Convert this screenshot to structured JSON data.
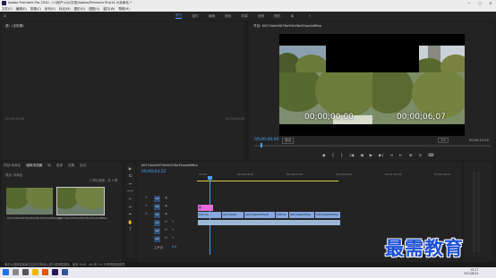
{
  "titlebar": {
    "title": "Adobe Premiere Pro 2020 - C:\\用户\\Lily\\文档\\Adobe\\Premiere Pro\\14.0\\未命名 *",
    "min": "—",
    "max": "▢",
    "close": "✕"
  },
  "menu": [
    "文件(F)",
    "编辑(E)",
    "剪辑(C)",
    "序列(S)",
    "标记(M)",
    "图形(G)",
    "视图(V)",
    "窗口(W)",
    "帮助(H)"
  ],
  "workspace": {
    "tabs": [
      "学习",
      "组件",
      "编辑",
      "颜色",
      "效果",
      "音频",
      "图形",
      "库"
    ],
    "active_index": 0,
    "more": "»"
  },
  "source": {
    "tab": "源：(无剪辑)",
    "tc_left": "00;00;00;00",
    "tc_right": "00;00;00;00"
  },
  "program": {
    "tab": "节目: 6027da0ef4f76e9fd1f6e35ba0aff6ba",
    "timecode": "00;00;00;00",
    "fit": "适合",
    "resolution": "1/2",
    "duration": "00;00;12;05",
    "overlay_left": "00;00;00;00",
    "overlay_right": "00;00;06;07",
    "transport": [
      "◆",
      "{",
      "}",
      "|◀",
      "◀",
      "▶",
      "▶|",
      "⇥",
      "⇤",
      "⊕",
      "⊙",
      "⌨"
    ]
  },
  "project": {
    "tabs": [
      "项目:未命名",
      "媒体浏览器",
      "库",
      "信息",
      "效果",
      "标记"
    ],
    "active_tab": 1,
    "label": "项目: 未命名",
    "count": "1 项已选择，共 2 项",
    "thumbs": [
      {
        "label": "6027da0ef4f76e9fd1f6e35ba0aff6ba.jpg"
      },
      {
        "label": "6027da0ef4f76e9fd1f6e35ba0aff6ba"
      }
    ]
  },
  "timeline": {
    "tab": "6027da0ef4f76e9fd1f6e35ba0aff6ba",
    "timecode": "00;00;03;22",
    "ruler": [
      "00;00",
      "00;00;16;00",
      "00;00;32;00",
      "00;00;48;00",
      "00;01;04;02",
      "00;01;20;02"
    ],
    "v_tracks": [
      "V3",
      "V2",
      "V1"
    ],
    "a_tracks": [
      "A1",
      "A2",
      "A3"
    ],
    "master": "主声道",
    "master_val": "0.0",
    "clip_v2": "图",
    "clip_v1": [
      "6027da",
      "6027da0ef",
      "6027da0ef4f76e9f",
      "6027da",
      "6027da0ef4f76e",
      "6027da0ef4f76e9"
    ]
  },
  "tools": [
    "▶",
    "⇆",
    "↔",
    "⟷",
    "✂",
    "⇔",
    "✒",
    "✋",
    "T"
  ],
  "status": "单击以选择或者单击空处并拖动以进行选择框选择。使用 Shift、Alt 和 Ctrl 可获得其他选项。",
  "taskbar": {
    "time": "15:17",
    "date": "2021/6/24"
  },
  "watermark": "最需教育"
}
